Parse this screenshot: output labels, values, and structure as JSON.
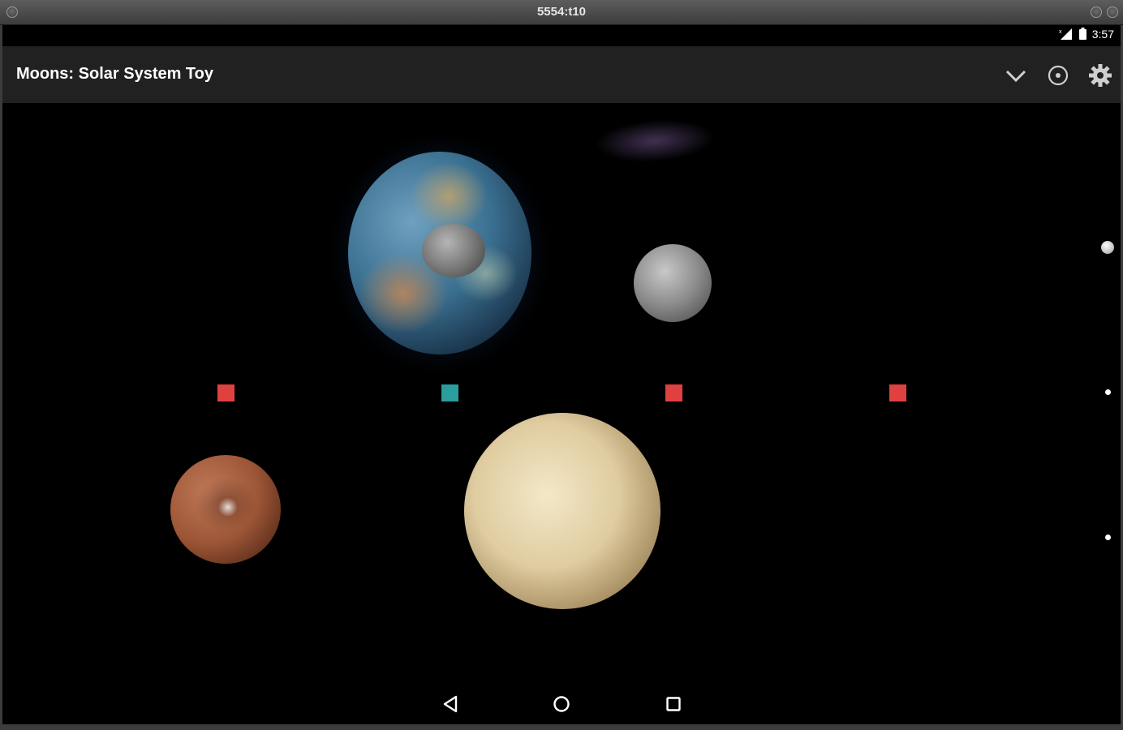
{
  "window": {
    "title": "5554:t10"
  },
  "status_bar": {
    "time": "3:57"
  },
  "app_bar": {
    "title": "Moons: Solar System Toy",
    "actions": [
      "chevron-down-icon",
      "target-icon",
      "gear-icon"
    ]
  },
  "scene": {
    "bodies": [
      "earth",
      "earth-moon",
      "grey-moon",
      "mars",
      "venus"
    ],
    "markers": [
      "#e04040",
      "#2a9d9f",
      "#e04040",
      "#e04040"
    ],
    "side_dots": 3
  },
  "nav_bar": {
    "buttons": [
      "back",
      "home",
      "recents"
    ]
  },
  "colors": {
    "app_bar": "#212121",
    "background": "#000000",
    "marker_red": "#e04040",
    "marker_teal": "#2a9d9f"
  }
}
